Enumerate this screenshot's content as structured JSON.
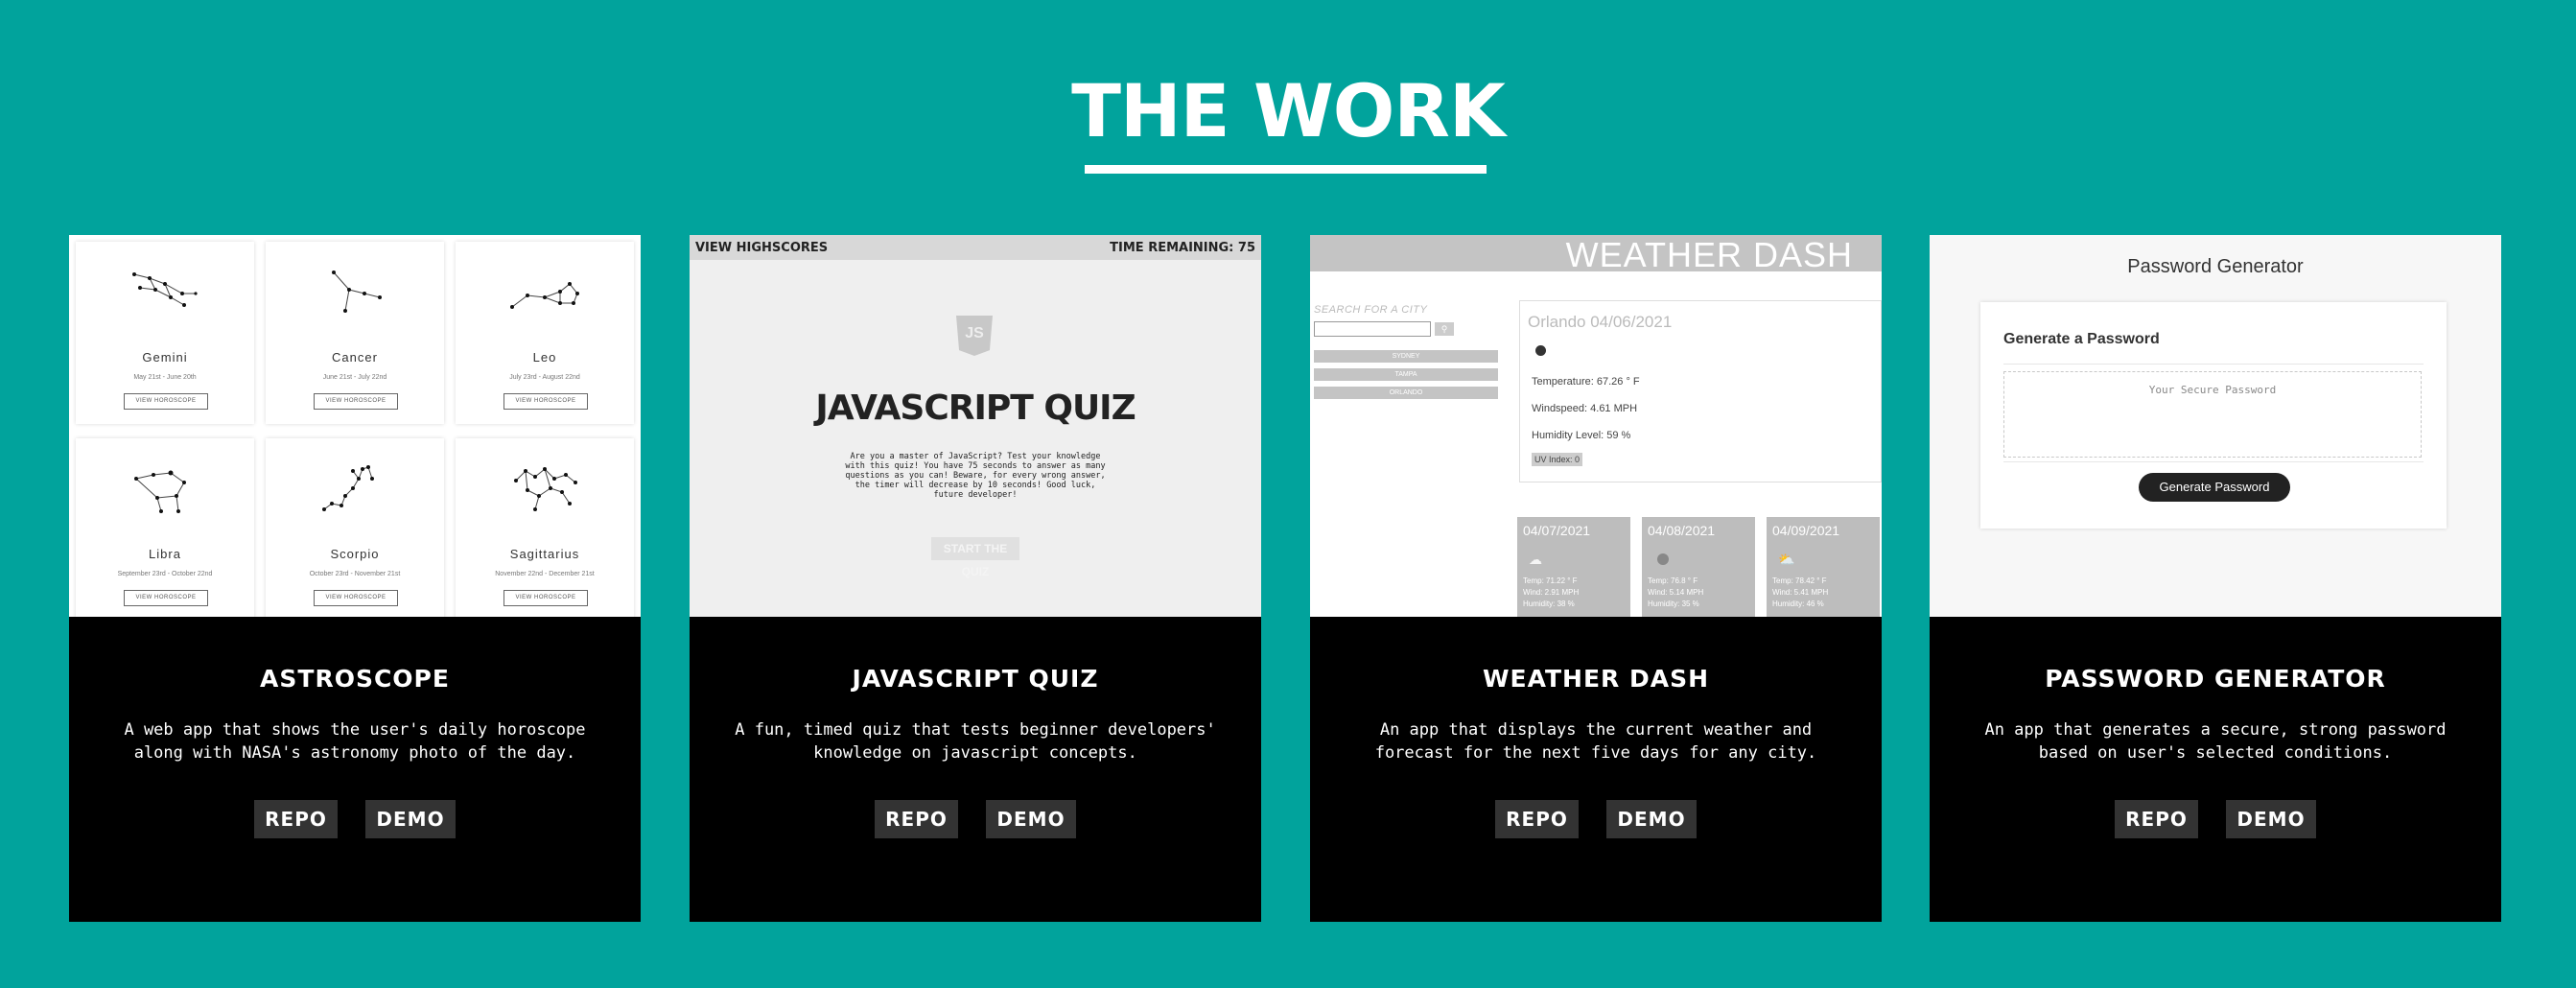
{
  "section": {
    "title": "THE WORK"
  },
  "projects": [
    {
      "title": "ASTROSCOPE",
      "description_line1": "A web app that shows the user's daily horoscope",
      "description_line2": "along with NASA's astronomy photo of the day.",
      "repo_label": "REPO",
      "demo_label": "DEMO",
      "preview": {
        "signs": [
          {
            "name": "Gemini",
            "dates": "May 21st - June 20th",
            "button": "VIEW HOROSCOPE"
          },
          {
            "name": "Cancer",
            "dates": "June 21st - July 22nd",
            "button": "VIEW HOROSCOPE"
          },
          {
            "name": "Leo",
            "dates": "July 23rd - August 22nd",
            "button": "VIEW HOROSCOPE"
          },
          {
            "name": "Libra",
            "dates": "September 23rd - October 22nd",
            "button": "VIEW HOROSCOPE"
          },
          {
            "name": "Scorpio",
            "dates": "October 23rd - November 21st",
            "button": "VIEW HOROSCOPE"
          },
          {
            "name": "Sagittarius",
            "dates": "November 22nd - December 21st",
            "button": "VIEW HOROSCOPE"
          }
        ]
      }
    },
    {
      "title": "JAVASCRIPT QUIZ",
      "description_line1": "A fun, timed quiz that tests beginner developers'",
      "description_line2": "knowledge on javascript concepts.",
      "repo_label": "REPO",
      "demo_label": "DEMO",
      "preview": {
        "view_highscores": "VIEW HIGHSCORES",
        "time_remaining": "TIME REMAINING: 75",
        "logo_text": "JS",
        "heading": "JAVASCRIPT QUIZ",
        "intro": [
          "Are you a master of JavaScript? Test your knowledge",
          "with this quiz! You have 75 seconds to answer as many",
          "questions as you can! Beware, for every wrong answer,",
          "the timer will decrease by 10 seconds! Good luck,",
          "future developer!"
        ],
        "start_button": "START THE QUIZ"
      }
    },
    {
      "title": "WEATHER DASH",
      "description_line1": "An app that displays the current weather and",
      "description_line2": "forecast for the next five days for any city.",
      "repo_label": "REPO",
      "demo_label": "DEMO",
      "preview": {
        "header": "WEATHER DASH",
        "search_label": "SEARCH FOR A CITY",
        "cities": [
          "SYDNEY",
          "TAMPA",
          "ORLANDO"
        ],
        "current": {
          "city_date": "Orlando 04/06/2021",
          "temperature": "Temperature: 67.26 ° F",
          "wind": "Windspeed: 4.61 MPH",
          "humidity": "Humidity Level: 59 %",
          "uv": "UV Index: 0"
        },
        "forecast": [
          {
            "date": "04/07/2021",
            "temp": "Temp: 71.22 ° F",
            "wind": "Wind: 2.91 MPH",
            "humidity": "Humidity: 38 %"
          },
          {
            "date": "04/08/2021",
            "temp": "Temp: 76.8 ° F",
            "wind": "Wind: 5.14 MPH",
            "humidity": "Humidity: 35 %"
          },
          {
            "date": "04/09/2021",
            "temp": "Temp: 78.42 ° F",
            "wind": "Wind: 5.41 MPH",
            "humidity": "Humidity: 46 %"
          }
        ]
      }
    },
    {
      "title": "PASSWORD GENERATOR",
      "description_line1": "An app that generates a secure, strong password",
      "description_line2": "based on user's selected conditions.",
      "repo_label": "REPO",
      "demo_label": "DEMO",
      "preview": {
        "page_title": "Password Generator",
        "card_title": "Generate a Password",
        "placeholder": "Your Secure Password",
        "button": "Generate Password"
      }
    }
  ]
}
